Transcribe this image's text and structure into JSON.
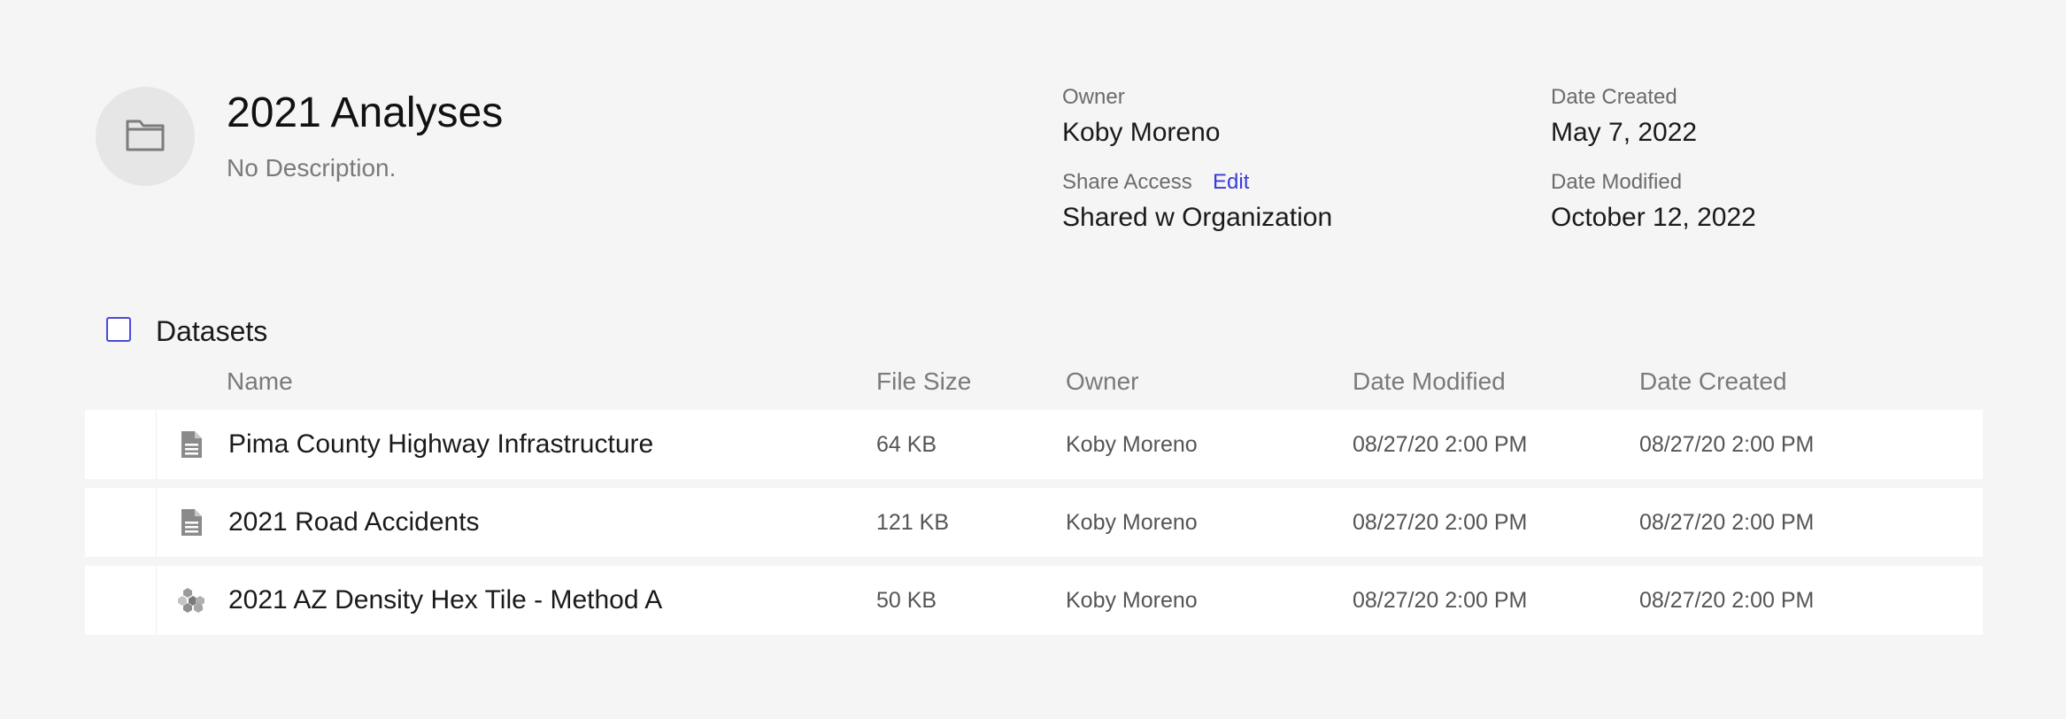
{
  "folder": {
    "title": "2021 Analyses",
    "description": "No Description.",
    "icon": "folder-icon"
  },
  "meta": {
    "owner_label": "Owner",
    "owner_value": "Koby Moreno",
    "share_label": "Share Access",
    "share_edit": "Edit",
    "share_value": "Shared w Organization",
    "created_label": "Date Created",
    "created_value": "May 7, 2022",
    "modified_label": "Date Modified",
    "modified_value": "October 12, 2022"
  },
  "datasets": {
    "title": "Datasets",
    "checked": false,
    "columns": {
      "name": "Name",
      "size": "File Size",
      "owner": "Owner",
      "modified": "Date Modified",
      "created": "Date Created"
    },
    "rows": [
      {
        "icon": "table-file-icon",
        "name": "Pima County Highway Infrastructure",
        "size": "64 KB",
        "owner": "Koby Moreno",
        "modified": "08/27/20 2:00 PM",
        "created": "08/27/20 2:00 PM"
      },
      {
        "icon": "table-file-icon",
        "name": "2021 Road Accidents",
        "size": "121 KB",
        "owner": "Koby Moreno",
        "modified": "08/27/20 2:00 PM",
        "created": "08/27/20 2:00 PM"
      },
      {
        "icon": "hex-tile-icon",
        "name": "2021 AZ Density Hex Tile - Method A",
        "size": "50 KB",
        "owner": "Koby Moreno",
        "modified": "08/27/20 2:00 PM",
        "created": "08/27/20 2:00 PM"
      }
    ]
  },
  "colors": {
    "background": "#f5f5f5",
    "accent": "#3b3bd6",
    "row_background": "#ffffff",
    "muted_text": "#7a7a7a"
  }
}
